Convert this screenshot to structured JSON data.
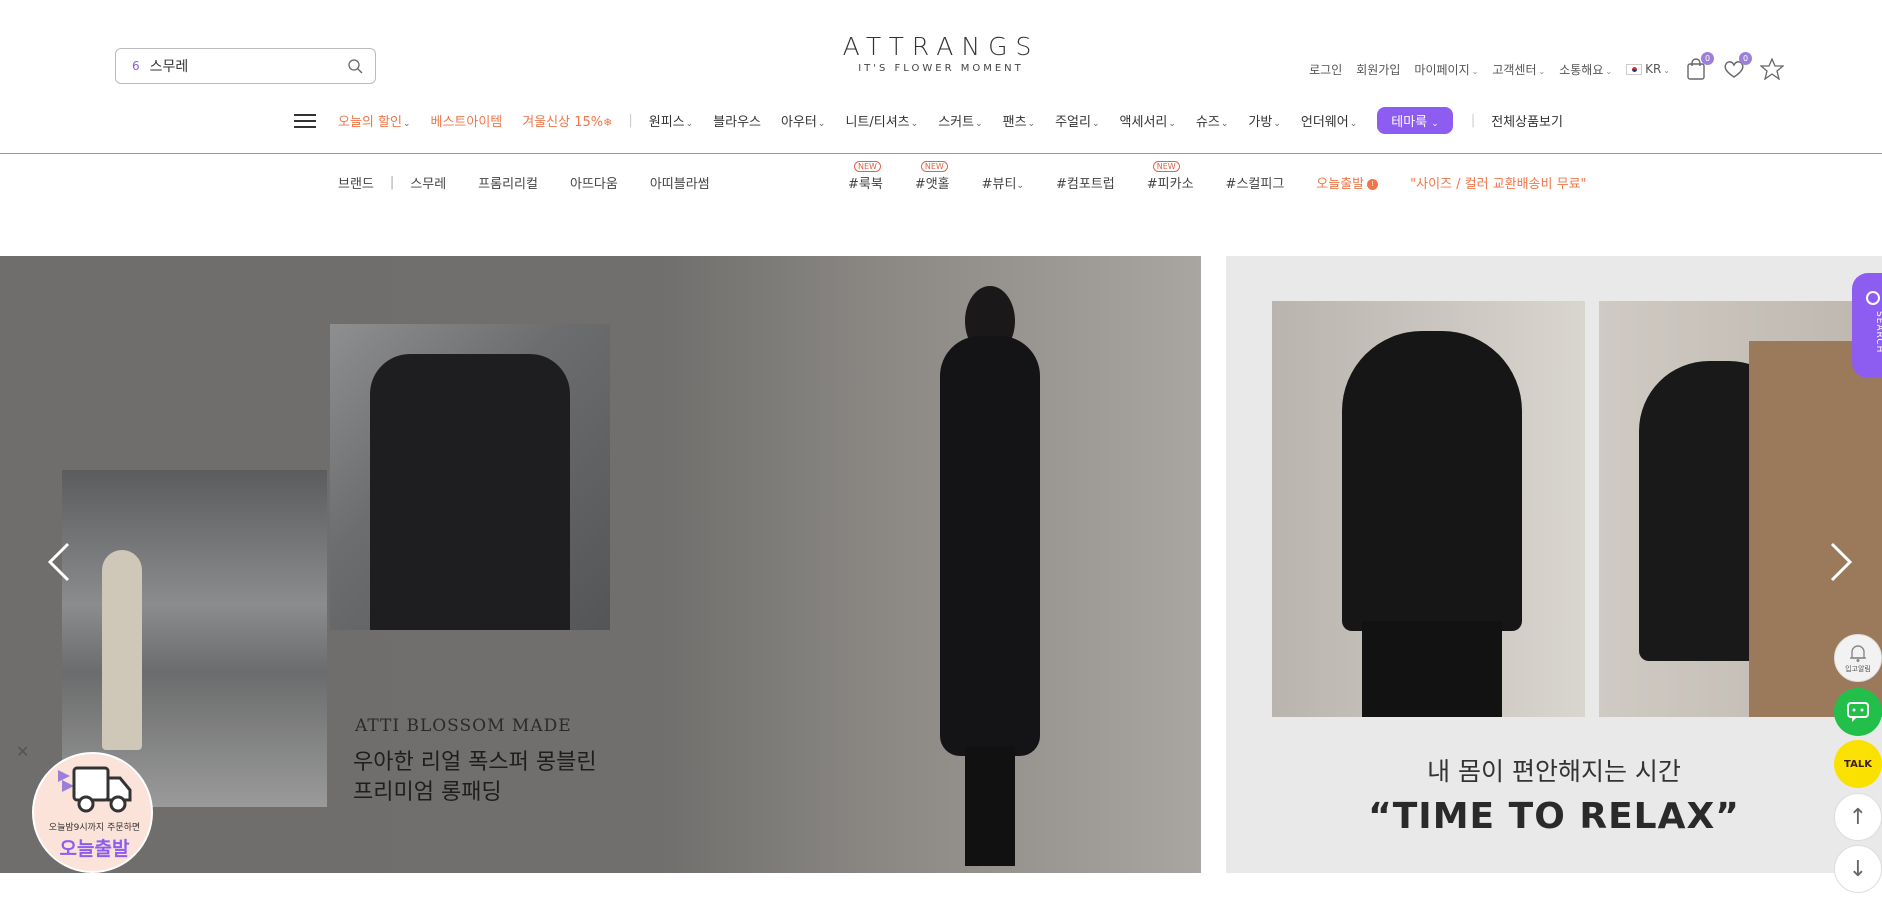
{
  "search": {
    "count": "6",
    "value": "스무레"
  },
  "logo": {
    "main": "ATTRANGS",
    "tagline": "IT'S FLOWER MOMENT"
  },
  "util": {
    "login": "로그인",
    "signup": "회원가입",
    "mypage": "마이페이지",
    "cs": "고객센터",
    "community": "소통해요",
    "lang": "KR",
    "cart_count": "0",
    "wish_count": "0"
  },
  "nav": {
    "sale_items": [
      "오늘의 할인",
      "베스트아이템",
      "겨울신상 15%"
    ],
    "categories": [
      "원피스",
      "블라우스",
      "아우터",
      "니트/티셔츠",
      "스커트",
      "팬츠",
      "주얼리",
      "액세서리",
      "슈즈",
      "가방",
      "언더웨어"
    ],
    "theme": "테마룩",
    "all": "전체상품보기"
  },
  "subnav": {
    "brand": "브랜드",
    "brands": [
      "스무레",
      "프롬리리컬",
      "아뜨다움",
      "아띠블라썸"
    ]
  },
  "tags": {
    "items": [
      "#룩북",
      "#앳홀",
      "#뷰티",
      "#컴포트럽",
      "#피카소",
      "#스컬피그"
    ],
    "new_label": "NEW",
    "today": "오늘출발",
    "promo": "\"사이즈 / 컬러 교환배송비 무료\""
  },
  "banner1": {
    "brand": "ATTI BLOSSOM MADE",
    "line1": "우아한 리얼 폭스퍼 몽블린",
    "line2": "프리미엄 롱패딩"
  },
  "banner2": {
    "line1": "내 몸이 편안해지는 시간",
    "line2": "“TIME TO RELAX”"
  },
  "floating": {
    "search": "SEARCH",
    "bell": "입고알림",
    "talk": "TALK",
    "delivery_small": "오늘밤9시까지 주문하면",
    "delivery_big": "오늘출발"
  },
  "colors": {
    "accent": "#8c5df0",
    "sale": "#f0764a"
  }
}
